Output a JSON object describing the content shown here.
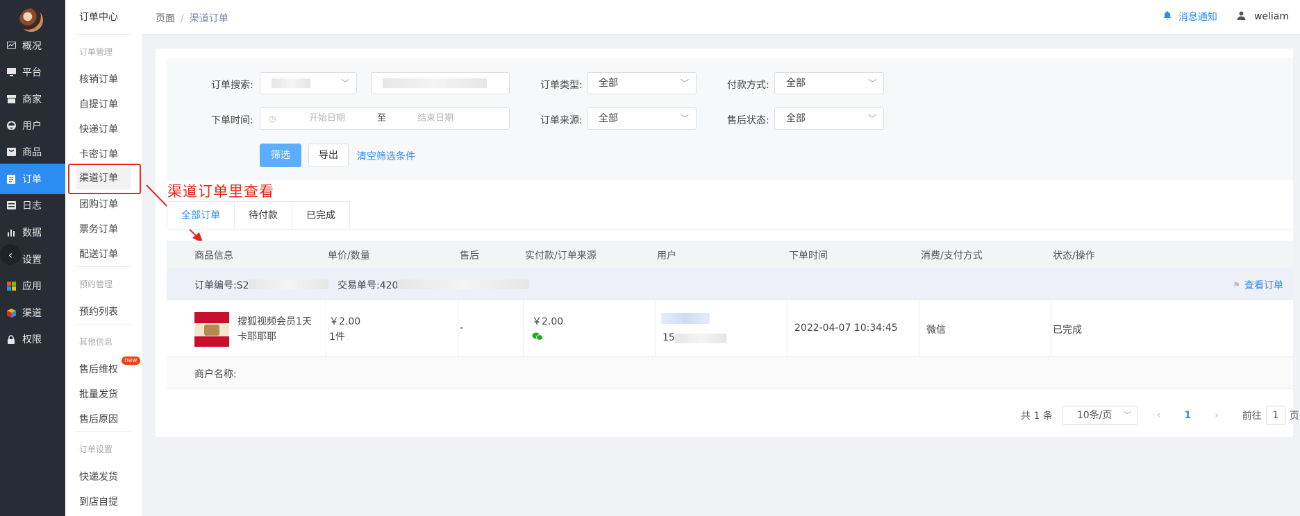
{
  "nav_primary": [
    {
      "label": "概况",
      "icon": "dashboard-icon"
    },
    {
      "label": "平台",
      "icon": "monitor-icon"
    },
    {
      "label": "商家",
      "icon": "store-icon"
    },
    {
      "label": "用户",
      "icon": "user-icon"
    },
    {
      "label": "商品",
      "icon": "goods-icon"
    },
    {
      "label": "订单",
      "icon": "order-icon",
      "active": true
    },
    {
      "label": "日志",
      "icon": "log-icon"
    },
    {
      "label": "数据",
      "icon": "bar-chart-icon"
    },
    {
      "label": "设置",
      "icon": "gear-icon"
    },
    {
      "label": "应用",
      "icon": "apps-icon"
    },
    {
      "label": "渠道",
      "icon": "cube-icon"
    },
    {
      "label": "权限",
      "icon": "lock-icon"
    }
  ],
  "nav_secondary": {
    "title": "订单中心",
    "group_order": "订单管理",
    "items_order": [
      "核销订单",
      "自提订单",
      "快递订单",
      "卡密订单",
      "渠道订单",
      "团购订单",
      "票务订单",
      "配送订单"
    ],
    "group_booking": "预约管理",
    "items_booking": [
      "预约列表"
    ],
    "group_other": "其他信息",
    "items_other": [
      "售后维权",
      "批量发货",
      "售后原因"
    ],
    "badge_new": "new",
    "group_settings": "订单设置",
    "items_settings": [
      "快递发货",
      "到店自提"
    ]
  },
  "header": {
    "crumb_root": "页面",
    "crumb_sep": "/",
    "crumb_current": "渠道订单",
    "notice": "消息通知",
    "username": "weliam"
  },
  "filters": {
    "search_label": "订单搜索:",
    "type_label": "订单类型:",
    "type_value": "全部",
    "pay_label": "付款方式:",
    "pay_value": "全部",
    "time_label": "下单时间:",
    "start_placeholder": "开始日期",
    "range_sep": "至",
    "end_placeholder": "结束日期",
    "source_label": "订单来源:",
    "source_value": "全部",
    "aftersale_label": "售后状态:",
    "aftersale_value": "全部",
    "btn_filter": "筛选",
    "btn_export": "导出",
    "btn_clear": "清空筛选条件"
  },
  "annotation": "渠道订单里查看",
  "tabs": [
    "全部订单",
    "待付款",
    "已完成"
  ],
  "table": {
    "headers": [
      "商品信息",
      "单价/数量",
      "售后",
      "实付款/订单来源",
      "用户",
      "下单时间",
      "消费/支付方式",
      "状态/操作"
    ],
    "order_no_label": "订单编号:S2",
    "trade_no_label": "交易单号:420",
    "view_order": "查看订单",
    "row": {
      "product_name_1": "搜狐视频会员1天",
      "product_name_2": "卡耶耶耶",
      "unit_price": "￥2.00",
      "quantity": "1件",
      "aftersale": "-",
      "paid": "￥2.00",
      "user_phone_prefix": "15",
      "order_time": "2022-04-07 10:34:45",
      "pay_method": "微信",
      "status": "已完成"
    },
    "merchant_label": "商户名称:"
  },
  "pagination": {
    "total": "共 1 条",
    "page_size": "10条/页",
    "current_page": "1",
    "goto_label": "前往",
    "goto_value": "1",
    "page_suffix": "页"
  }
}
